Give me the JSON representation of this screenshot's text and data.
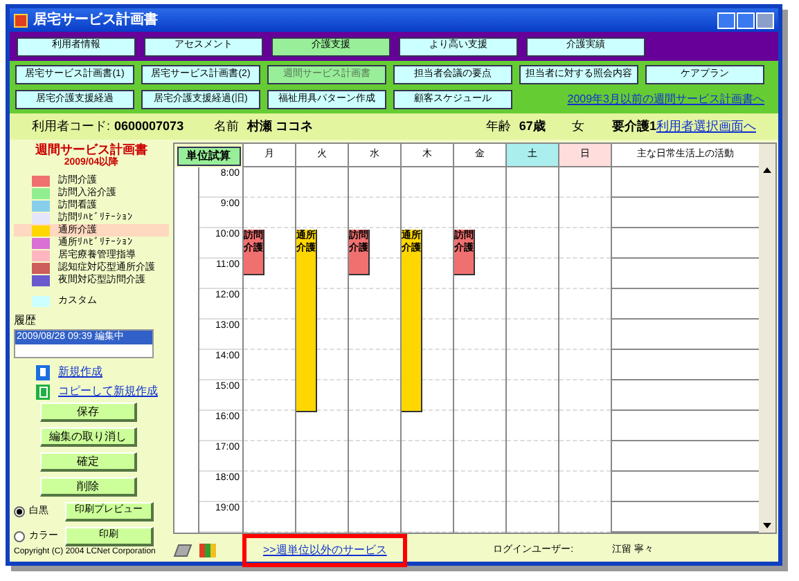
{
  "window": {
    "title": "居宅サービス計画書"
  },
  "nav_tabs": [
    {
      "label": "利用者情報",
      "selected": false
    },
    {
      "label": "アセスメント",
      "selected": false
    },
    {
      "label": "介護支援",
      "selected": true
    },
    {
      "label": "より高い支援",
      "selected": false
    },
    {
      "label": "介護実績",
      "selected": false
    }
  ],
  "sub_tabs": [
    {
      "label": "居宅サービス計画書(1)",
      "selected": false
    },
    {
      "label": "居宅サービス計画書(2)",
      "selected": false
    },
    {
      "label": "週間サービス計画書",
      "selected": true
    },
    {
      "label": "担当者会議の要点",
      "selected": false
    },
    {
      "label": "担当者に対する照会内容",
      "selected": false
    },
    {
      "label": "ケアプラン",
      "selected": false
    },
    {
      "label": "居宅介護支援経過",
      "selected": false
    },
    {
      "label": "居宅介護支援経過(旧)",
      "selected": false
    },
    {
      "label": "福祉用具パターン作成",
      "selected": false
    },
    {
      "label": "顧客スケジュール",
      "selected": false
    }
  ],
  "old_plan_link": "2009年3月以前の週間サービス計画書へ",
  "info": {
    "code_label": "利用者コード:",
    "code": "0600007073",
    "name_label": "名前",
    "name": "村瀬 ココネ",
    "age_label": "年齢",
    "age": "67歳",
    "sex": "女",
    "care_level": "要介護1"
  },
  "select_user_link": "利用者選択画面へ",
  "legend": {
    "title": "週間サービス計画書",
    "subtitle": "2009/04以降",
    "items": [
      {
        "label": "訪問介護",
        "color": "#f07070",
        "selected": false
      },
      {
        "label": "訪問入浴介護",
        "color": "#90ee90",
        "selected": false
      },
      {
        "label": "訪問看護",
        "color": "#87ceeb",
        "selected": false
      },
      {
        "label": "訪問ﾘﾊﾋﾞﾘﾃｰｼｮﾝ",
        "color": "#e6e6fa",
        "selected": false
      },
      {
        "label": "通所介護",
        "color": "#ffd700",
        "selected": true
      },
      {
        "label": "通所ﾘﾊﾋﾞﾘﾃｰｼｮﾝ",
        "color": "#da70d6",
        "selected": false
      },
      {
        "label": "居宅療養管理指導",
        "color": "#ffb6c1",
        "selected": false
      },
      {
        "label": "認知症対応型通所介護",
        "color": "#cd5c5c",
        "selected": false
      },
      {
        "label": "夜間対応型訪問介護",
        "color": "#6a5acd",
        "selected": false
      }
    ],
    "custom": {
      "label": "カスタム",
      "color": "#ccffff"
    }
  },
  "history": {
    "label": "履歴",
    "entries": [
      {
        "text": "2009/08/28 09:39 編集中",
        "selected": true
      }
    ]
  },
  "actions": [
    {
      "kind": "new",
      "label": "新規作成"
    },
    {
      "kind": "copy",
      "label": "コピーして新規作成"
    }
  ],
  "buttons": [
    {
      "label": "保存"
    },
    {
      "label": "編集の取り消し"
    },
    {
      "label": "確定"
    },
    {
      "label": "削除"
    }
  ],
  "print_modes": [
    {
      "label": "白黒",
      "selected": true,
      "button": "印刷プレビュー"
    },
    {
      "label": "カラー",
      "selected": false,
      "button": "印刷"
    }
  ],
  "copyright": "Copyright (C) 2004 LCNet Corporation",
  "schedule": {
    "calc_button": "単位試算",
    "activity_header": "主な日常生活上の活動",
    "times": [
      "8:00",
      "9:00",
      "10:00",
      "11:00",
      "12:00",
      "13:00",
      "14:00",
      "15:00",
      "16:00",
      "17:00",
      "18:00",
      "19:00"
    ],
    "days": [
      {
        "label": "月",
        "kind": "weekday",
        "slots": [
          {
            "kind": "empty"
          },
          {
            "kind": "empty"
          },
          {
            "kind": "empty"
          },
          {
            "kind": "empty"
          },
          {
            "kind": "event",
            "label": "訪問介護",
            "color": "#f07070"
          },
          {
            "kind": "continue"
          },
          {
            "kind": "continue"
          }
        ]
      },
      {
        "label": "火",
        "kind": "weekday",
        "slots": [
          {
            "kind": "empty"
          },
          {
            "kind": "empty"
          },
          {
            "kind": "empty"
          },
          {
            "kind": "empty"
          },
          {
            "kind": "event",
            "label": "通所介護",
            "color": "#ffd700"
          },
          {
            "kind": "continue"
          },
          {
            "kind": "continue"
          },
          {
            "kind": "continue"
          },
          {
            "kind": "continue"
          },
          {
            "kind": "continue"
          },
          {
            "kind": "continue"
          },
          {
            "kind": "continue"
          },
          {
            "kind": "continue"
          },
          {
            "kind": "continue"
          },
          {
            "kind": "continue"
          },
          {
            "kind": "continue"
          }
        ]
      },
      {
        "label": "水",
        "kind": "weekday",
        "slots": [
          {
            "kind": "empty"
          },
          {
            "kind": "empty"
          },
          {
            "kind": "empty"
          },
          {
            "kind": "empty"
          },
          {
            "kind": "event",
            "label": "訪問介護",
            "color": "#f07070"
          },
          {
            "kind": "continue"
          },
          {
            "kind": "continue"
          }
        ]
      },
      {
        "label": "木",
        "kind": "weekday",
        "slots": [
          {
            "kind": "empty"
          },
          {
            "kind": "empty"
          },
          {
            "kind": "empty"
          },
          {
            "kind": "empty"
          },
          {
            "kind": "event",
            "label": "通所介護",
            "color": "#ffd700"
          },
          {
            "kind": "continue"
          },
          {
            "kind": "continue"
          },
          {
            "kind": "continue"
          },
          {
            "kind": "continue"
          },
          {
            "kind": "continue"
          },
          {
            "kind": "continue"
          },
          {
            "kind": "continue"
          },
          {
            "kind": "continue"
          },
          {
            "kind": "continue"
          },
          {
            "kind": "continue"
          },
          {
            "kind": "continue"
          }
        ]
      },
      {
        "label": "金",
        "kind": "weekday",
        "slots": [
          {
            "kind": "empty"
          },
          {
            "kind": "empty"
          },
          {
            "kind": "empty"
          },
          {
            "kind": "empty"
          },
          {
            "kind": "event",
            "label": "訪問介護",
            "color": "#f07070"
          },
          {
            "kind": "continue"
          },
          {
            "kind": "continue"
          }
        ]
      },
      {
        "label": "土",
        "kind": "saturday"
      },
      {
        "label": "日",
        "kind": "sunday"
      }
    ]
  },
  "other_services_link": {
    "label": ">>週単位以外のサービス",
    "highlighted": true
  },
  "login": {
    "label": "ログインユーザー:",
    "user": "江留 寧々"
  }
}
